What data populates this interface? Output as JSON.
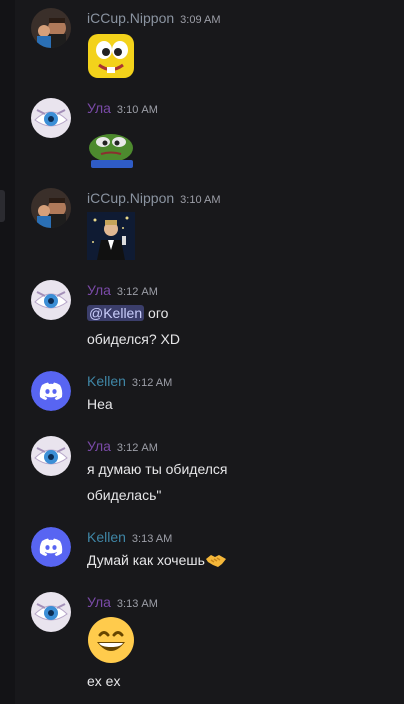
{
  "messages": [
    {
      "author": "iCCup.Nippon",
      "time": "3:09 AM"
    },
    {
      "author": "Ула",
      "time": "3:10 AM"
    },
    {
      "author": "iCCup.Nippon",
      "time": "3:10 AM"
    },
    {
      "author": "Ула",
      "time": "3:12 AM",
      "mention": "@Kellen",
      "text_after_mention": " ого",
      "line2": "обиделся? XD"
    },
    {
      "author": "Kellen",
      "time": "3:12 AM",
      "text": "Неа"
    },
    {
      "author": "Ула",
      "time": "3:12 AM",
      "line1": "я думаю ты обиделся",
      "line2": "обиделась\""
    },
    {
      "author": "Kellen",
      "time": "3:13 AM",
      "text": "Думай как хочешь"
    },
    {
      "author": "Ула",
      "time": "3:13 AM",
      "text": "ex ex"
    }
  ],
  "icons": {
    "avatar_nippon": "avatar-photo",
    "avatar_ula": "avatar-eye",
    "avatar_kellen": "discord-logo",
    "emoji_1": "yellow-cartoon-face-emoji",
    "emoji_2": "pepe-frog-emoji",
    "emoji_3": "leonardo-toast-emoji",
    "handshake": "handshake-emoji",
    "grin": "grinning-face-emoji"
  },
  "colors": {
    "background": "#18181b",
    "username_nippon": "#8a93a0",
    "username_ula": "#7a4aa8",
    "username_kellen": "#3f86a6",
    "discord_blurple": "#5865f2",
    "mention_bg": "#3b3e6b"
  }
}
